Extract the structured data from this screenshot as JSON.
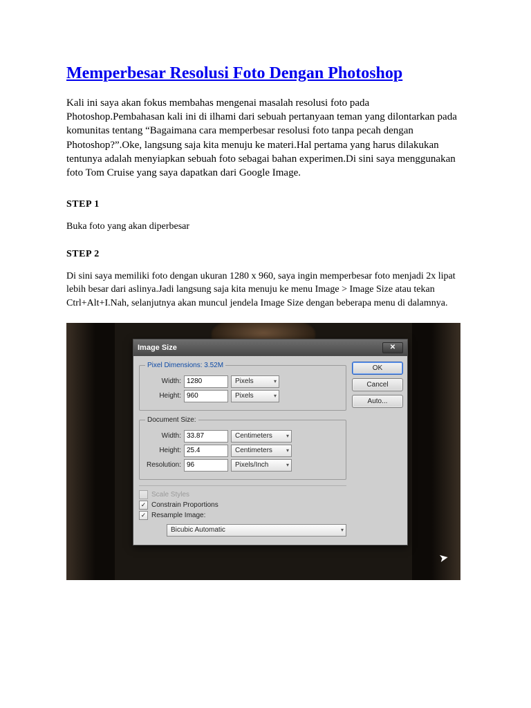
{
  "title": "Memperbesar Resolusi Foto Dengan Photoshop",
  "intro": "Kali ini saya akan fokus membahas mengenai masalah resolusi foto pada Photoshop.Pembahasan kali ini di ilhami dari sebuah pertanyaan teman yang dilontarkan pada komunitas tentang “Bagaimana cara memperbesar resolusi foto tanpa pecah dengan Photoshop?”.Oke, langsung saja kita menuju ke materi.Hal pertama yang harus dilakukan tentunya adalah menyiapkan sebuah foto sebagai bahan experimen.Di sini saya menggunakan foto Tom Cruise yang saya dapatkan dari Google Image.",
  "step1": {
    "head": "STEP 1",
    "body": "Buka foto yang akan diperbesar"
  },
  "step2": {
    "head": "STEP 2",
    "body": "Di sini saya memiliki foto dengan ukuran 1280 x 960, saya ingin memperbesar foto menjadi 2x lipat lebih besar dari aslinya.Jadi langsung saja kita menuju ke menu Image > Image Size atau tekan Ctrl+Alt+I.Nah, selanjutnya akan muncul jendela Image Size dengan beberapa menu di dalamnya."
  },
  "dialog": {
    "title": "Image Size",
    "close": "✕",
    "buttons": {
      "ok": "OK",
      "cancel": "Cancel",
      "auto": "Auto..."
    },
    "pixdim": {
      "legend": "Pixel Dimensions:  3.52M",
      "width_label": "Width:",
      "width_value": "1280",
      "width_unit": "Pixels",
      "height_label": "Height:",
      "height_value": "960",
      "height_unit": "Pixels"
    },
    "docsize": {
      "legend": "Document Size:",
      "width_label": "Width:",
      "width_value": "33.87",
      "width_unit": "Centimeters",
      "height_label": "Height:",
      "height_value": "25.4",
      "height_unit": "Centimeters",
      "res_label": "Resolution:",
      "res_value": "96",
      "res_unit": "Pixels/Inch"
    },
    "checks": {
      "scale": "Scale Styles",
      "constrain": "Constrain Proportions",
      "resample": "Resample Image:"
    },
    "resample_method": "Bicubic Automatic"
  }
}
